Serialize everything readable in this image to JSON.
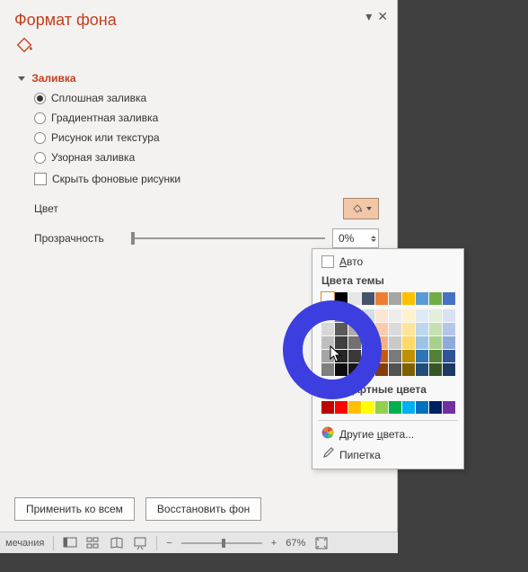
{
  "panel": {
    "title": "Формат фона",
    "section": "Заливка",
    "radios": {
      "solid": "Сплошная заливка",
      "gradient": "Градиентная заливка",
      "picture": "Рисунок или текстура",
      "pattern": "Узорная заливка"
    },
    "checkbox": "Скрыть фоновые рисунки",
    "color_label": "Цвет",
    "transparency_label": "Прозрачность",
    "transparency_value": "0%",
    "apply_all": "Применить ко всем",
    "reset": "Восстановить фон"
  },
  "color_popup": {
    "auto": "Авто",
    "theme": "Цвета темы",
    "standard": "Стандартные цвета",
    "more": "Другие цвета...",
    "eyedropper": "Пипетка",
    "theme_row": [
      "#FFFFFF",
      "#000000",
      "#E7E6E6",
      "#44546A",
      "#ED7D31",
      "#A5A5A5",
      "#FFC000",
      "#5B9BD5",
      "#70AD47",
      "#4472C4"
    ],
    "theme_shades": [
      [
        "#F2F2F2",
        "#808080",
        "#D0CECE",
        "#D6DCE4",
        "#FBE5D5",
        "#EDEDED",
        "#FFF2CC",
        "#DEEBF6",
        "#E2EFD9",
        "#D9E2F3"
      ],
      [
        "#D8D8D8",
        "#595959",
        "#AEABAB",
        "#ADB9CA",
        "#F7CBAC",
        "#DBDBDB",
        "#FEE599",
        "#BDD7EE",
        "#C5E0B3",
        "#B4C6E7"
      ],
      [
        "#BFBFBF",
        "#3F3F3F",
        "#757070",
        "#8496B0",
        "#F4B183",
        "#C9C9C9",
        "#FFD965",
        "#9CC3E5",
        "#A8D08D",
        "#8EAADB"
      ],
      [
        "#A5A5A5",
        "#262626",
        "#3A3838",
        "#323F4F",
        "#C55A11",
        "#7B7B7B",
        "#BF9000",
        "#2E75B5",
        "#538135",
        "#2F5496"
      ],
      [
        "#7F7F7F",
        "#0C0C0C",
        "#171616",
        "#222A35",
        "#833C0B",
        "#525252",
        "#7F6000",
        "#1E4E79",
        "#375623",
        "#1F3864"
      ]
    ],
    "standard_row": [
      "#C00000",
      "#FF0000",
      "#FFC000",
      "#FFFF00",
      "#92D050",
      "#00B050",
      "#00B0F0",
      "#0070C0",
      "#002060",
      "#7030A0"
    ]
  },
  "statusbar": {
    "notes": "мечания",
    "zoom": "67%"
  }
}
